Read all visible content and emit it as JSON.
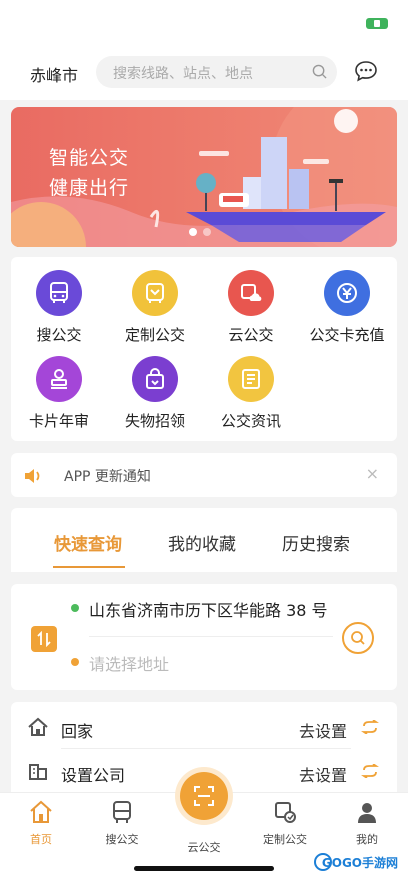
{
  "header": {
    "city": "赤峰市",
    "search_placeholder": "搜索线路、站点、地点"
  },
  "banner": {
    "line1": "智能公交",
    "line2": "健康出行"
  },
  "services": [
    {
      "label": "搜公交",
      "icon": "bus-icon",
      "color": "#6a4ad8"
    },
    {
      "label": "定制公交",
      "icon": "custom-bus-icon",
      "color": "#f1c23a"
    },
    {
      "label": "云公交",
      "icon": "cloud-bus-icon",
      "color": "#e8564f"
    },
    {
      "label": "公交卡充值",
      "icon": "card-recharge-icon",
      "color": "#3f6fe0"
    },
    {
      "label": "卡片年审",
      "icon": "stamp-icon",
      "color": "#a446d8"
    },
    {
      "label": "失物招领",
      "icon": "lost-found-icon",
      "color": "#7b3ed0"
    },
    {
      "label": "公交资讯",
      "icon": "news-icon",
      "color": "#f2c540"
    }
  ],
  "notice": {
    "text": "APP 更新通知",
    "close": "×"
  },
  "query_tabs": [
    "快速查询",
    "我的收藏",
    "历史搜索"
  ],
  "route": {
    "from": "山东省济南市历下区华能路 38 号",
    "to_placeholder": "请选择地址"
  },
  "favorites": [
    {
      "label": "回家",
      "action": "去设置",
      "icon": "home-icon"
    },
    {
      "label": "设置公司",
      "action": "去设置",
      "icon": "building-icon"
    }
  ],
  "tabbar": [
    {
      "label": "首页",
      "icon": "home-icon",
      "active": true
    },
    {
      "label": "搜公交",
      "icon": "bus-icon",
      "active": false
    },
    {
      "label": "云公交",
      "icon": "scan-icon",
      "active": false
    },
    {
      "label": "定制公交",
      "icon": "custom-bus-icon",
      "active": false
    },
    {
      "label": "我的",
      "icon": "user-icon",
      "active": false
    }
  ],
  "watermark": "GOGO手游网",
  "colors": {
    "accent": "#e89838",
    "banner": "#ec7468"
  }
}
